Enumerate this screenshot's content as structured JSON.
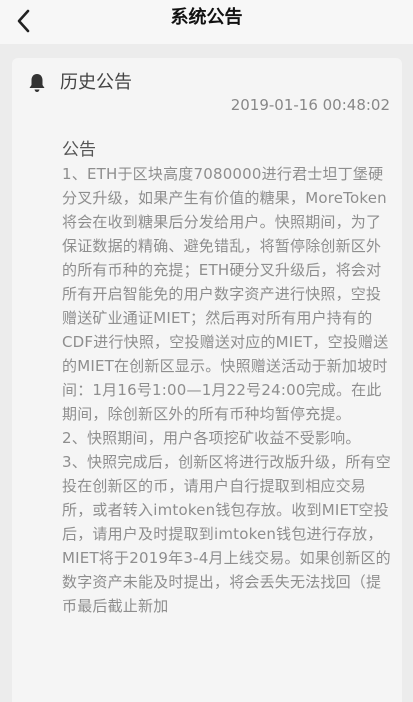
{
  "nav": {
    "title": "系统公告",
    "back_icon": "chevron-left-icon"
  },
  "card": {
    "section_label": "历史公告",
    "section_icon": "bell-icon",
    "date": "2019-01-16 00:48:02",
    "notice_title": "公告",
    "paragraphs": [
      "1、ETH于区块高度7080000进行君士坦丁堡硬分叉升级，如果产生有价值的糖果，MoreToken将会在收到糖果后分发给用户。快照期间，为了保证数据的精确、避免错乱，将暂停除创新区外的所有币种的充提；ETH硬分叉升级后，将会对所有开启智能免的用户数字资产进行快照，空投赠送矿业通证MIET；然后再对所有用户持有的CDF进行快照，空投赠送对应的MIET，空投赠送的MIET在创新区显示。快照赠送活动于新加坡时间：1月16号1:00—1月22号24:00完成。在此期间，除创新区外的所有币种均暂停充提。",
      "2、快照期间，用户各项挖矿收益不受影响。",
      "3、快照完成后，创新区将进行改版升级，所有空投在创新区的币，请用户自行提取到相应交易所，或者转入imtoken钱包存放。收到MIET空投后，请用户及时提取到imtoken钱包进行存放，MIET将于2019年3-4月上线交易。如果创新区的数字资产未能及时提出，将会丢失无法找回（提币最后截止新加"
    ]
  },
  "colors": {
    "background": "#ececec",
    "card": "#f5f5f5",
    "body_text": "#8e8e8e"
  }
}
